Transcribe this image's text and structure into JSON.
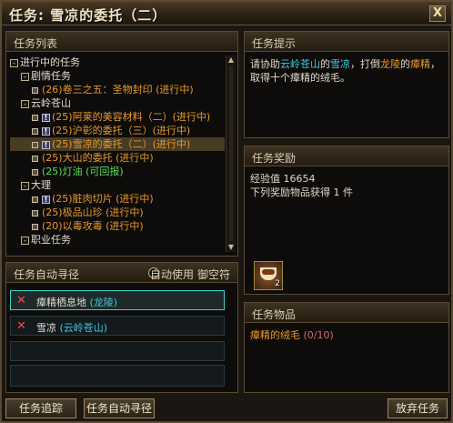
{
  "window": {
    "title": "任务: 雪凉的委托（二）",
    "close_label": "X"
  },
  "quest_list": {
    "header": "任务列表",
    "tree": [
      {
        "indent": 0,
        "toggle": "-",
        "label": "进行中的任务",
        "color": "white"
      },
      {
        "indent": 1,
        "toggle": "-",
        "label": "剧情任务",
        "color": "white"
      },
      {
        "indent": 2,
        "marker": "sq",
        "label": "(26)卷三之五：圣物封印 (进行中)",
        "color": "orange"
      },
      {
        "indent": 1,
        "toggle": "-",
        "label": "云岭苍山",
        "color": "white"
      },
      {
        "indent": 2,
        "marker": "bang",
        "label": "(25)阿莱的美容材料（二）(进行中)",
        "color": "orange"
      },
      {
        "indent": 2,
        "marker": "bang",
        "label": "(25)沪彰的委托（三）(进行中)",
        "color": "orange"
      },
      {
        "indent": 2,
        "marker": "bang",
        "label": "(25)雪凉的委托（二）(进行中)",
        "color": "orange",
        "selected": true
      },
      {
        "indent": 2,
        "marker": "sq",
        "label": "(25)大山的委托 (进行中)",
        "color": "orange"
      },
      {
        "indent": 2,
        "marker": "sq",
        "label": "(25)灯油 (可回报)",
        "color": "green"
      },
      {
        "indent": 1,
        "toggle": "-",
        "label": "大理",
        "color": "white"
      },
      {
        "indent": 2,
        "marker": "bang",
        "label": "(25)脏肉切片 (进行中)",
        "color": "orange"
      },
      {
        "indent": 2,
        "marker": "sq",
        "label": "(25)极品山珍 (进行中)",
        "color": "orange"
      },
      {
        "indent": 2,
        "marker": "sq",
        "label": "(20)以毒攻毒 (进行中)",
        "color": "orange"
      },
      {
        "indent": 1,
        "toggle": "-",
        "label": "职业任务",
        "color": "white"
      }
    ]
  },
  "auto_path": {
    "header": "任务自动寻径",
    "auto_use_label": "自动使用",
    "talisman_label": "御空符",
    "rows": [
      {
        "name": "瘴精栖息地",
        "loc": "(龙陵)",
        "active": true
      },
      {
        "name": "雪凉",
        "loc": "(云岭苍山)",
        "active": false
      }
    ]
  },
  "hint": {
    "header": "任务提示",
    "text_a": "请协助",
    "loc": "云岭苍山",
    "text_b": "的",
    "npc": "雪凉",
    "text_c": "，打倒",
    "area": "龙陵",
    "text_d": "的",
    "target": "瘴精",
    "text_e": "，取得十个瘴精的绒毛。"
  },
  "reward": {
    "header": "任务奖励",
    "exp_label": "经验值",
    "exp_value": "16654",
    "items_label": "下列奖励物品获得 1 件",
    "item_name": "tea-cup-icon",
    "item_count": "2"
  },
  "quest_items": {
    "header": "任务物品",
    "item": "瘴精的绒毛",
    "progress": "(0/10)"
  },
  "buttons": {
    "track": "任务追踪",
    "auto_path": "任务自动寻径",
    "abandon": "放弃任务"
  }
}
